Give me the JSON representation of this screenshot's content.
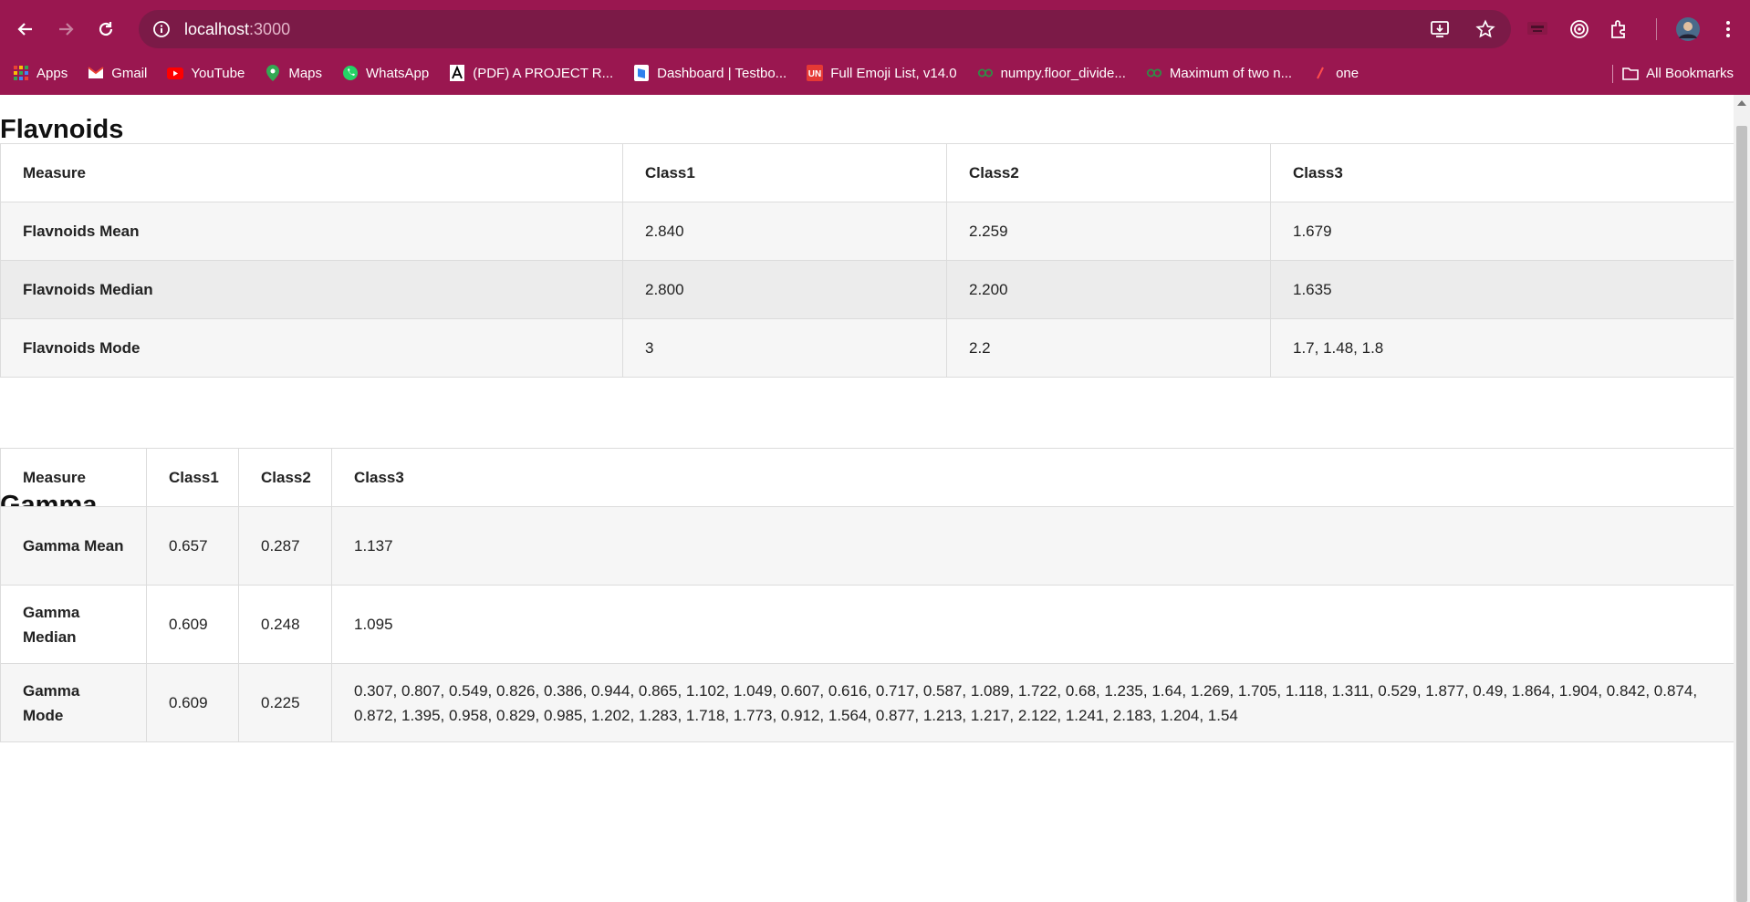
{
  "browser": {
    "url_host": "localhost",
    "url_port": ":3000",
    "bookmarks": [
      {
        "label": "Apps",
        "icon": "apps-grid-icon",
        "color": "#f4b400"
      },
      {
        "label": "Gmail",
        "icon": "gmail-icon",
        "color": "#ea4335"
      },
      {
        "label": "YouTube",
        "icon": "youtube-icon",
        "color": "#ff0000"
      },
      {
        "label": "Maps",
        "icon": "maps-pin-icon",
        "color": "#34a853"
      },
      {
        "label": "WhatsApp",
        "icon": "whatsapp-icon",
        "color": "#25d366"
      },
      {
        "label": "(PDF) A PROJECT R...",
        "icon": "academia-icon",
        "color": "#ffffff"
      },
      {
        "label": "Dashboard | Testbo...",
        "icon": "testbook-icon",
        "color": "#2f80ed"
      },
      {
        "label": "Full Emoji List, v14.0",
        "icon": "unicode-icon",
        "color": "#e53935"
      },
      {
        "label": "numpy.floor_divide...",
        "icon": "geeksforgeeks-icon",
        "color": "#2f8d46"
      },
      {
        "label": "Maximum of two n...",
        "icon": "geeksforgeeks-icon",
        "color": "#2f8d46"
      },
      {
        "label": "one",
        "icon": "slash-icon",
        "color": "#ff4d4d"
      }
    ],
    "all_bookmarks_label": "All Bookmarks"
  },
  "sections": {
    "flavnoids": {
      "title": "Flavnoids",
      "headers": [
        "Measure",
        "Class1",
        "Class2",
        "Class3"
      ],
      "rows": [
        [
          "Flavnoids Mean",
          "2.840",
          "2.259",
          "1.679"
        ],
        [
          "Flavnoids Median",
          "2.800",
          "2.200",
          "1.635"
        ],
        [
          "Flavnoids Mode",
          "3",
          "2.2",
          "1.7, 1.48, 1.8"
        ]
      ]
    },
    "gamma": {
      "title": "Gamma",
      "headers": [
        "Measure",
        "Class1",
        "Class2",
        "Class3"
      ],
      "rows": [
        [
          "Gamma Mean",
          "0.657",
          "0.287",
          "1.137"
        ],
        [
          "Gamma Median",
          "0.609",
          "0.248",
          "1.095"
        ],
        [
          "Gamma Mode",
          "0.609",
          "0.225",
          "0.307, 0.807, 0.549, 0.826, 0.386, 0.944, 0.865, 1.102, 1.049, 0.607, 0.616, 0.717, 0.587, 1.089, 1.722, 0.68, 1.235, 1.64, 1.269, 1.705, 1.118, 1.311, 0.529, 1.877, 0.49, 1.864, 1.904, 0.842, 0.874, 0.872, 1.395, 0.958, 0.829, 0.985, 1.202, 1.283, 1.718, 1.773, 0.912, 1.564, 0.877, 1.213, 1.217, 2.122, 1.241, 2.183, 1.204, 1.54"
        ]
      ]
    }
  }
}
